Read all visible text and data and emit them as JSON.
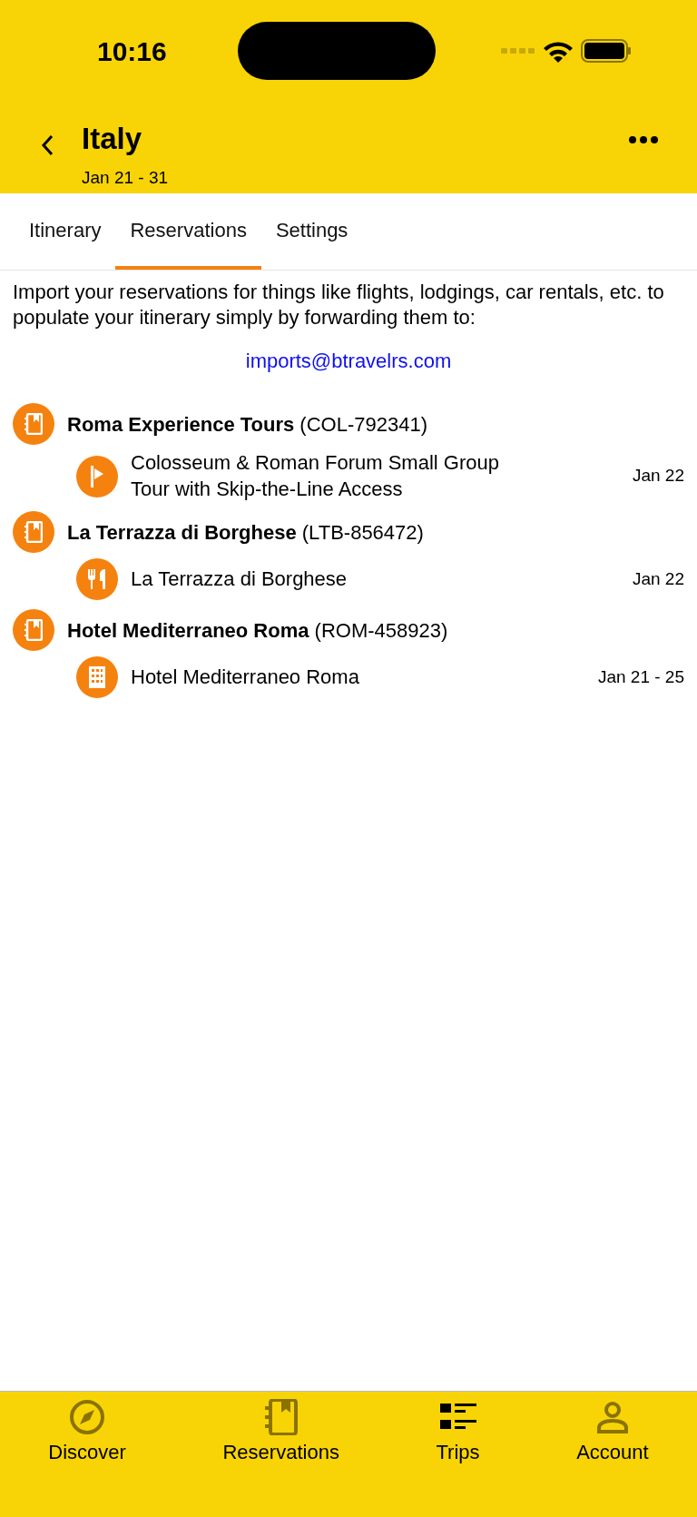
{
  "status_bar": {
    "time": "10:16"
  },
  "header": {
    "title": "Italy",
    "subtitle": "Jan 21 - 31"
  },
  "tabs": [
    {
      "label": "Itinerary",
      "selected": false
    },
    {
      "label": "Reservations",
      "selected": true
    },
    {
      "label": "Settings",
      "selected": false
    }
  ],
  "intro": "Import your reservations for things like flights, lodgings, car rentals, etc. to populate your itinerary simply by forwarding them to:",
  "email": "imports@btravelrs.com",
  "reservations": [
    {
      "name": "Roma Experience Tours",
      "code": "(COL-792341)",
      "items": [
        {
          "kind": "tour",
          "title": "Colosseum & Roman Forum Small Group Tour with Skip-the-Line Access",
          "date": "Jan 22"
        }
      ]
    },
    {
      "name": "La Terrazza di Borghese",
      "code": "(LTB-856472)",
      "items": [
        {
          "kind": "restaurant",
          "title": "La Terrazza di Borghese",
          "date": "Jan 22"
        }
      ]
    },
    {
      "name": "Hotel Mediterraneo Roma",
      "code": "(ROM-458923)",
      "items": [
        {
          "kind": "hotel",
          "title": "Hotel Mediterraneo Roma",
          "date": "Jan 21 - 25"
        }
      ]
    }
  ],
  "bottom_nav": [
    {
      "kind": "discover",
      "label": "Discover",
      "selected": false
    },
    {
      "kind": "reservations",
      "label": "Reservations",
      "selected": false
    },
    {
      "kind": "trips",
      "label": "Trips",
      "selected": true
    },
    {
      "kind": "account",
      "label": "Account",
      "selected": false
    }
  ]
}
